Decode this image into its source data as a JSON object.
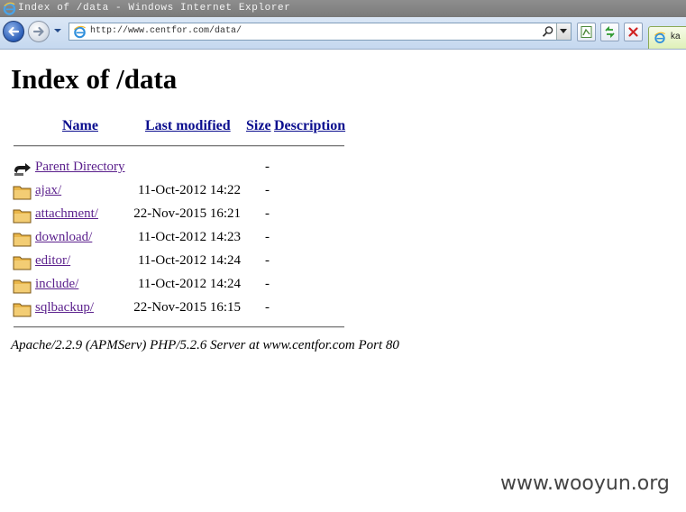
{
  "window": {
    "title": "Index of /data - Windows Internet Explorer"
  },
  "toolbar": {
    "address_url": "http://www.centfor.com/data/",
    "tab_label": "ka"
  },
  "page": {
    "heading": "Index of /data",
    "columns": {
      "name": "Name",
      "last_modified": "Last modified",
      "size": "Size",
      "description": "Description"
    },
    "parent": {
      "name": "Parent Directory",
      "size": "-"
    },
    "entries": [
      {
        "name": "ajax/",
        "modified": "11-Oct-2012 14:22",
        "size": "-"
      },
      {
        "name": "attachment/",
        "modified": "22-Nov-2015 16:21",
        "size": "-"
      },
      {
        "name": "download/",
        "modified": "11-Oct-2012 14:23",
        "size": "-"
      },
      {
        "name": "editor/",
        "modified": "11-Oct-2012 14:24",
        "size": "-"
      },
      {
        "name": "include/",
        "modified": "11-Oct-2012 14:24",
        "size": "-"
      },
      {
        "name": "sqlbackup/",
        "modified": "22-Nov-2015 16:15",
        "size": "-"
      }
    ],
    "server_signature": "Apache/2.2.9 (APMServ) PHP/5.2.6 Server at www.centfor.com Port 80"
  },
  "watermark": "www.wooyun.org",
  "colors": {
    "link": "#0a0d8e",
    "visited_link": "#5a1f8c",
    "titlebar": "#848484",
    "folder": "#e9b64a"
  }
}
